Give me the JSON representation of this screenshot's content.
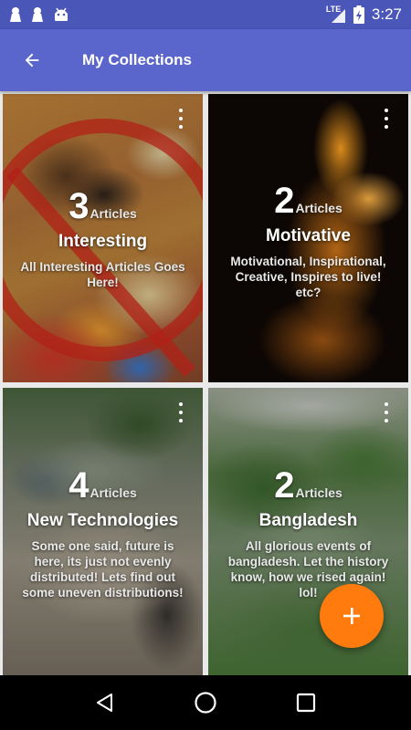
{
  "status_bar": {
    "time": "3:27",
    "network": "LTE",
    "icons": [
      "notification-icon",
      "notification-icon",
      "android-icon",
      "signal-icon",
      "battery-charging-icon"
    ]
  },
  "app_bar": {
    "title": "My Collections",
    "back_icon": "arrow-back-icon"
  },
  "collections": [
    {
      "count": "3",
      "count_unit": "Articles",
      "title": "Interesting",
      "description": "All Interesting Articles Goes Here!",
      "menu_icon": "more-vert-icon"
    },
    {
      "count": "2",
      "count_unit": "Articles",
      "title": "Motivative",
      "description": "Motivational, Inspirational, Creative, Inspires to live! etc?",
      "menu_icon": "more-vert-icon"
    },
    {
      "count": "4",
      "count_unit": "Articles",
      "title": "New Technologies",
      "description": "Some one said, future is here, its just not evenly distributed! Lets find out some uneven distributions!",
      "menu_icon": "more-vert-icon"
    },
    {
      "count": "2",
      "count_unit": "Articles",
      "title": "Bangladesh",
      "description": "All glorious events of bangladesh. Let the history know, how we rised again! lol!",
      "menu_icon": "more-vert-icon"
    }
  ],
  "fab": {
    "icon": "plus-icon"
  },
  "nav_bar": {
    "icons": [
      "back-triangle-icon",
      "home-circle-icon",
      "recents-square-icon"
    ]
  },
  "colors": {
    "status_bar": "#4a56b8",
    "app_bar": "#5b66cc",
    "fab": "#ff7b0d"
  }
}
